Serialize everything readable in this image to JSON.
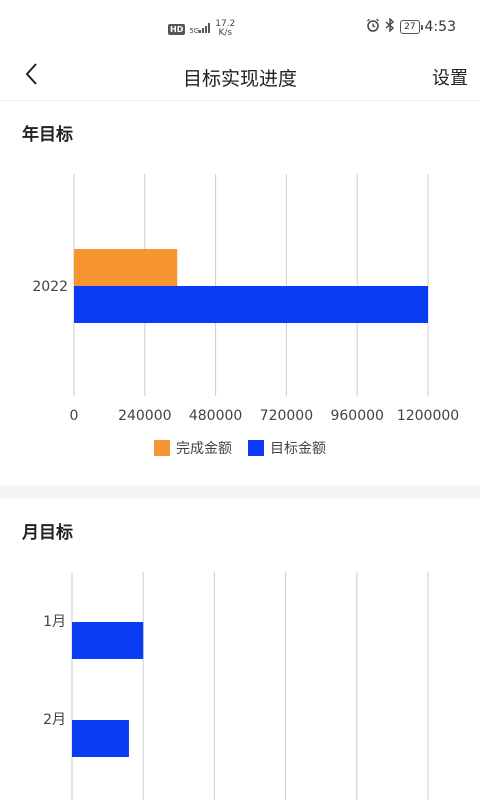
{
  "statusbar": {
    "hd": "HD",
    "signal": "5G",
    "speed_value": "17.2",
    "speed_unit": "K/s",
    "battery": "27",
    "time": "4:53"
  },
  "navbar": {
    "title": "目标实现进度",
    "action": "设置"
  },
  "colors": {
    "completed": "#F79530",
    "target": "#0A3CF5",
    "grid": "#CCCCCC",
    "band": "#F5F5F5"
  },
  "annual": {
    "title": "年目标",
    "chart_data": {
      "type": "bar",
      "orientation": "horizontal",
      "categories": [
        "2022"
      ],
      "series": [
        {
          "name": "完成金额",
          "values": [
            350000
          ]
        },
        {
          "name": "目标金额",
          "values": [
            1200000
          ]
        }
      ],
      "xlim": [
        0,
        1200000
      ],
      "xticks": [
        "0",
        "240000",
        "480000",
        "720000",
        "960000",
        "1200000"
      ],
      "grid": true,
      "legend": "bottom"
    }
  },
  "monthly": {
    "title": "月目标",
    "chart_data": {
      "type": "bar",
      "orientation": "horizontal",
      "categories": [
        "1月",
        "2月"
      ],
      "series": [
        {
          "values": [
            50,
            40
          ]
        }
      ],
      "xlim": [
        0,
        250
      ],
      "grid": true
    }
  }
}
